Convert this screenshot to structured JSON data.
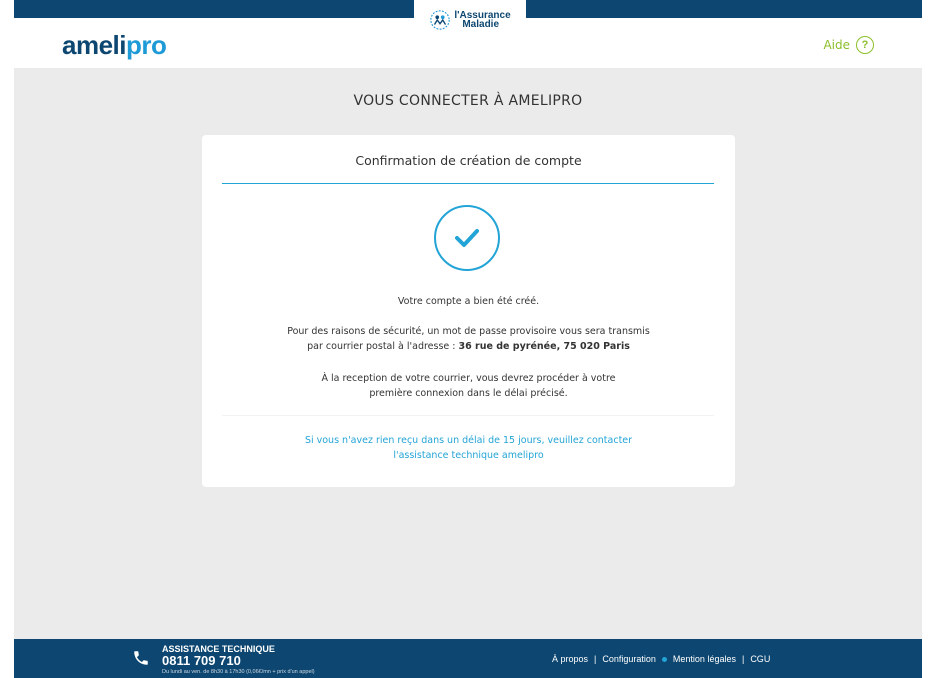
{
  "header": {
    "logo": {
      "part1": "ameli",
      "part2": "pro"
    },
    "assurance": {
      "line1": "l'Assurance",
      "line2": "Maladie"
    },
    "aide_label": "Aide",
    "help_symbol": "?"
  },
  "main": {
    "page_title": "VOUS CONNECTER À AMELIPRO",
    "card": {
      "title": "Confirmation de création de compte",
      "created_msg": "Votre compte a bien été créé.",
      "security_line1": "Pour des raisons de sécurité, un mot de passe provisoire vous sera transmis",
      "security_line2_prefix": "par courrier postal à l'adresse :",
      "address": "36 rue de pyrénée, 75 020 Paris",
      "reception_line1": "À la reception de votre courrier, vous devrez procéder à votre",
      "reception_line2": "première connexion dans le délai précisé.",
      "contact_line1": "Si vous n'avez rien reçu dans un délai de 15 jours, veuillez contacter",
      "contact_line2": "l'assistance technique amelipro"
    }
  },
  "footer": {
    "assistance_title": "ASSISTANCE TECHNIQUE",
    "phone_number": "0811 709 710",
    "hours": "Du lundi au ven. de 8h30 à 17h30 (0,06€/mn + prix d'un appel)",
    "links": {
      "a_propos": "À propos",
      "configuration": "Configuration",
      "mentions": "Mention légales",
      "cgu": "CGU"
    }
  },
  "colors": {
    "navy": "#0d4771",
    "accent_blue": "#23a4d6",
    "help_green": "#8bbf2b",
    "background": "#ebebeb"
  },
  "icons": {
    "logo_badge": "assurance-maladie-emblem",
    "help": "question-circle-icon",
    "success": "check-circle-icon",
    "phone": "phone-icon",
    "separator_dot": "dot-icon"
  }
}
